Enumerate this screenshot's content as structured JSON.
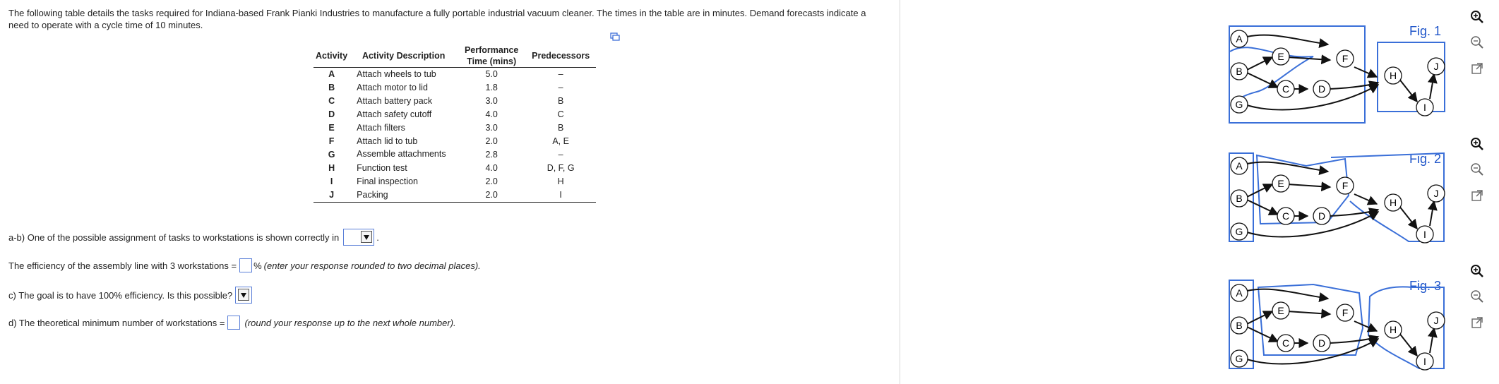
{
  "intro": "The following table details the tasks required for Indiana-based Frank Pianki Industries to manufacture a fully portable industrial vacuum cleaner. The times in the table are in minutes. Demand forecasts indicate a need to operate with a cycle time of 10 minutes.",
  "table": {
    "headers": {
      "activity": "Activity",
      "description": "Activity Description",
      "time_line1": "Performance",
      "time_line2": "Time (mins)",
      "predecessors": "Predecessors"
    },
    "rows": [
      {
        "activity": "A",
        "description": "Attach wheels to tub",
        "time": "5.0",
        "predecessors": "–"
      },
      {
        "activity": "B",
        "description": "Attach motor to lid",
        "time": "1.8",
        "predecessors": "–"
      },
      {
        "activity": "C",
        "description": "Attach battery pack",
        "time": "3.0",
        "predecessors": "B"
      },
      {
        "activity": "D",
        "description": "Attach safety cutoff",
        "time": "4.0",
        "predecessors": "C"
      },
      {
        "activity": "E",
        "description": "Attach filters",
        "time": "3.0",
        "predecessors": "B"
      },
      {
        "activity": "F",
        "description": "Attach lid to tub",
        "time": "2.0",
        "predecessors": "A, E"
      },
      {
        "activity": "G",
        "description": "Assemble attachments",
        "time": "2.8",
        "predecessors": "–"
      },
      {
        "activity": "H",
        "description": "Function test",
        "time": "4.0",
        "predecessors": "D, F, G"
      },
      {
        "activity": "I",
        "description": "Final inspection",
        "time": "2.0",
        "predecessors": "H"
      },
      {
        "activity": "J",
        "description": "Packing",
        "time": "2.0",
        "predecessors": "I"
      }
    ]
  },
  "questions": {
    "ab": {
      "text": "a-b) One of the possible assignment of tasks to workstations is shown correctly in",
      "suffix": "."
    },
    "efficiency": {
      "text": "The efficiency of the assembly line with 3 workstations =",
      "unit": "%",
      "hint": "(enter your response rounded to two decimal places)."
    },
    "c": {
      "text": "c) The goal is to have 100% efficiency. Is this possible?"
    },
    "d": {
      "text": "d) The theoretical minimum number of workstations =",
      "hint": "(round your response up to the next whole number)."
    }
  },
  "figures": {
    "labels": [
      "Fig. 1",
      "Fig. 2",
      "Fig. 3"
    ],
    "node_labels": [
      "A",
      "B",
      "G",
      "E",
      "C",
      "F",
      "D",
      "H",
      "J",
      "I"
    ]
  },
  "icons": [
    "copy-icon",
    "zoom-in-icon",
    "zoom-out-icon",
    "popout-icon"
  ],
  "colors": {
    "accent": "#1f55c9",
    "input_border": "#5a7fd8",
    "text": "#222222"
  }
}
